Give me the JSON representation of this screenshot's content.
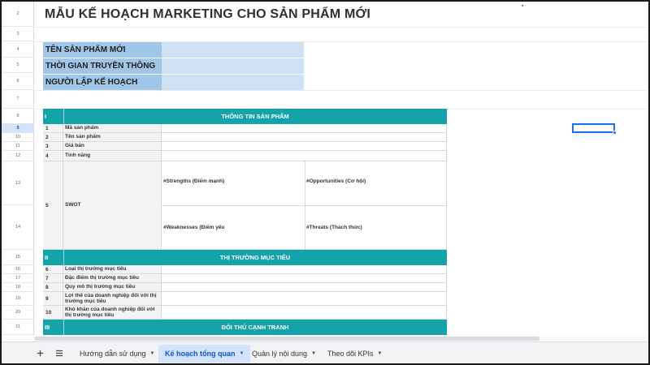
{
  "title": "MẪU KẾ HOẠCH MARKETING CHO SẢN PHẨM MỚI",
  "row_numbers": [
    "2",
    "3",
    "4",
    "5",
    "6",
    "7",
    "8",
    "9",
    "10",
    "11",
    "12",
    "13",
    "14",
    "15",
    "16",
    "17",
    "18",
    "19",
    "20",
    "21"
  ],
  "active_row": "9",
  "info_fields": [
    {
      "label": "TÊN SẢN PHẨM MỚI",
      "value": ""
    },
    {
      "label": "THỜI GIAN TRUYỀN THÔNG",
      "value": ""
    },
    {
      "label": "NGƯỜI LẬP KẾ HOẠCH",
      "value": ""
    }
  ],
  "sections": [
    {
      "num": "I",
      "label": "THÔNG TIN SẢN PHẨM"
    },
    {
      "num": "II",
      "label": "THỊ TRƯỜNG MỤC TIÊU"
    },
    {
      "num": "III",
      "label": "ĐỐI THỦ CẠNH TRANH"
    }
  ],
  "product_rows": [
    {
      "num": "1",
      "label": "Mã sản phẩm"
    },
    {
      "num": "2",
      "label": "Tên sản phẩm"
    },
    {
      "num": "3",
      "label": "Giá bán"
    },
    {
      "num": "4",
      "label": "Tính năng"
    }
  ],
  "swot": {
    "num": "5",
    "label": "SWOT",
    "strengths": "#Strengths (Điểm mạnh)",
    "opportunities": "#Opportunities (Cơ hội)",
    "weaknesses": "#Weaknesses (Điểm yếu",
    "threats": "#Threats (Thách thức)"
  },
  "market_rows": [
    {
      "num": "6",
      "label": "Loại thị trường mục tiêu"
    },
    {
      "num": "7",
      "label": "Đặc điểm thị trường mục tiêu"
    },
    {
      "num": "8",
      "label": "Quy mô thị trường mục tiêu"
    },
    {
      "num": "9",
      "label": "Lợi thế của doanh nghiệp đối với thị trường mục tiêu"
    },
    {
      "num": "10",
      "label": "Khó khăn của doanh nghiệp đối với thị trường mục tiêu"
    }
  ],
  "tabs": [
    {
      "label": "Hướng dẫn sử dụng",
      "active": false
    },
    {
      "label": "Kế hoạch tổng quan",
      "active": true
    },
    {
      "label": "Quản lý nội dung",
      "active": false
    },
    {
      "label": "Theo dõi KPIs",
      "active": false
    }
  ],
  "icons": {
    "add_sheet": "plus-icon",
    "all_sheets": "list-icon",
    "tab_menu": "caret-down-icon"
  },
  "colors": {
    "section_header": "#14a3a9",
    "info_label_bg": "#9fc5e8",
    "info_value_bg": "#cfe2f3",
    "selection": "#1a73e8",
    "active_tab": "#d3e3fd"
  }
}
